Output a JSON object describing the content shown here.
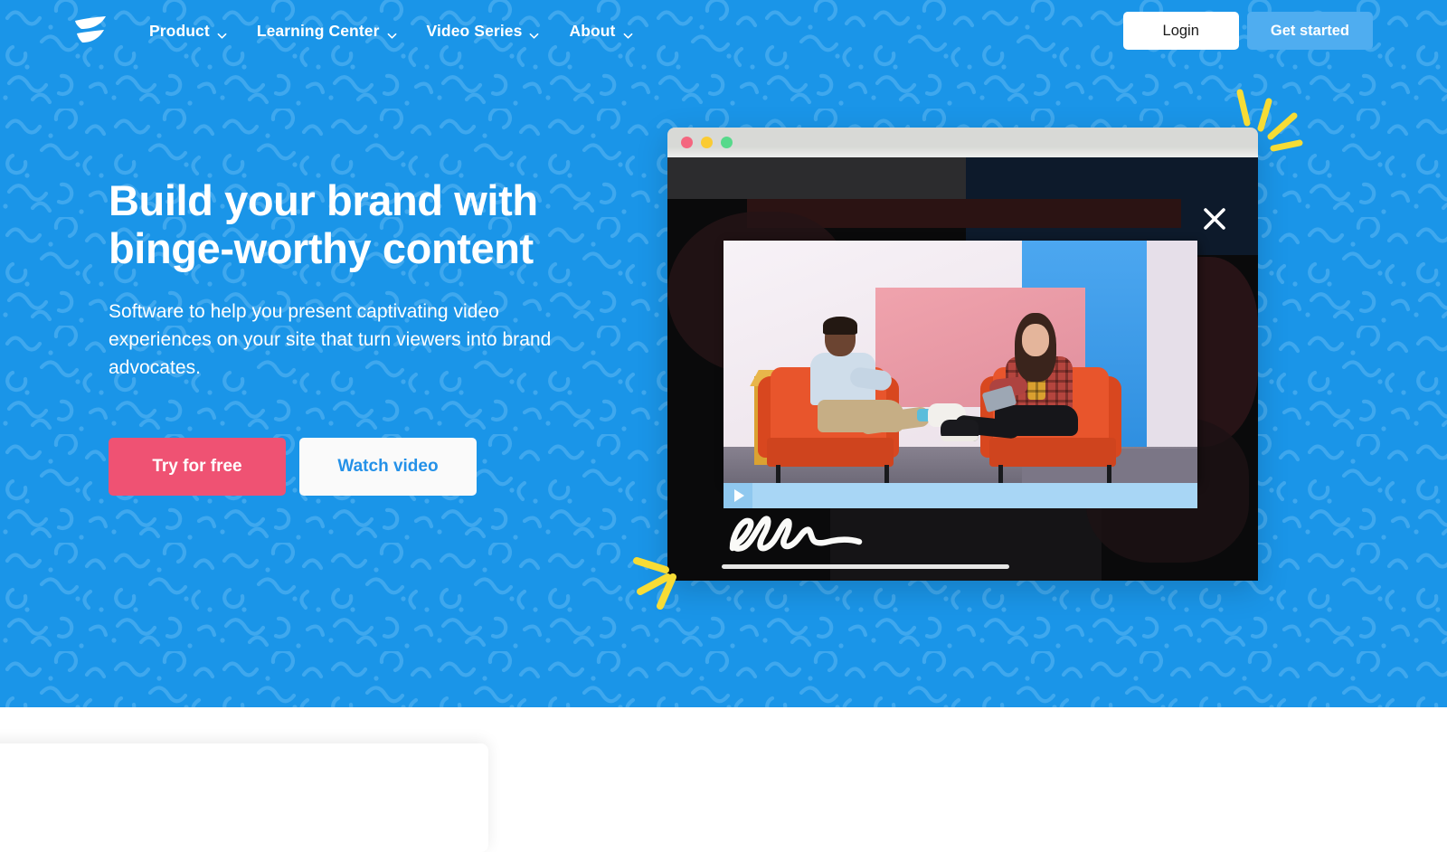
{
  "colors": {
    "brand_blue": "#1A95E8",
    "pattern_blue": "#3FA8EE",
    "accent_pink": "#EF5273",
    "accent_yellow": "#F7DC35",
    "button_blue": "#4FADF0",
    "link_blue": "#2491E8",
    "window_titlebar": "#D8D9D6",
    "playbar_blue": "#A8D6F5"
  },
  "nav": {
    "logo_name": "wistia-logo",
    "links": [
      {
        "label": "Product",
        "has_caret": true
      },
      {
        "label": "Learning Center",
        "has_caret": true
      },
      {
        "label": "Video Series",
        "has_caret": true
      },
      {
        "label": "About",
        "has_caret": true
      }
    ],
    "login_label": "Login",
    "get_started_label": "Get started"
  },
  "hero": {
    "headline": "Build your brand with binge-worthy content",
    "subhead": "Software to help you present captivating video experiences on your site that turn viewers into brand advocates.",
    "primary_cta": "Try for free",
    "secondary_cta": "Watch video"
  },
  "window": {
    "traffic_lights": [
      "red",
      "yellow",
      "green"
    ],
    "close_icon": "close-x-icon",
    "play_icon": "play-triangle-icon",
    "signature_text": "ellen",
    "video_scene": "two people seated in orange armchairs on a colorful studio set"
  },
  "decorations": {
    "sparkle_top_right": "yellow-sparkle-marks",
    "sparkle_bottom_left": "yellow-sparkle-marks",
    "background_pattern": "blue-squiggle-pattern"
  }
}
